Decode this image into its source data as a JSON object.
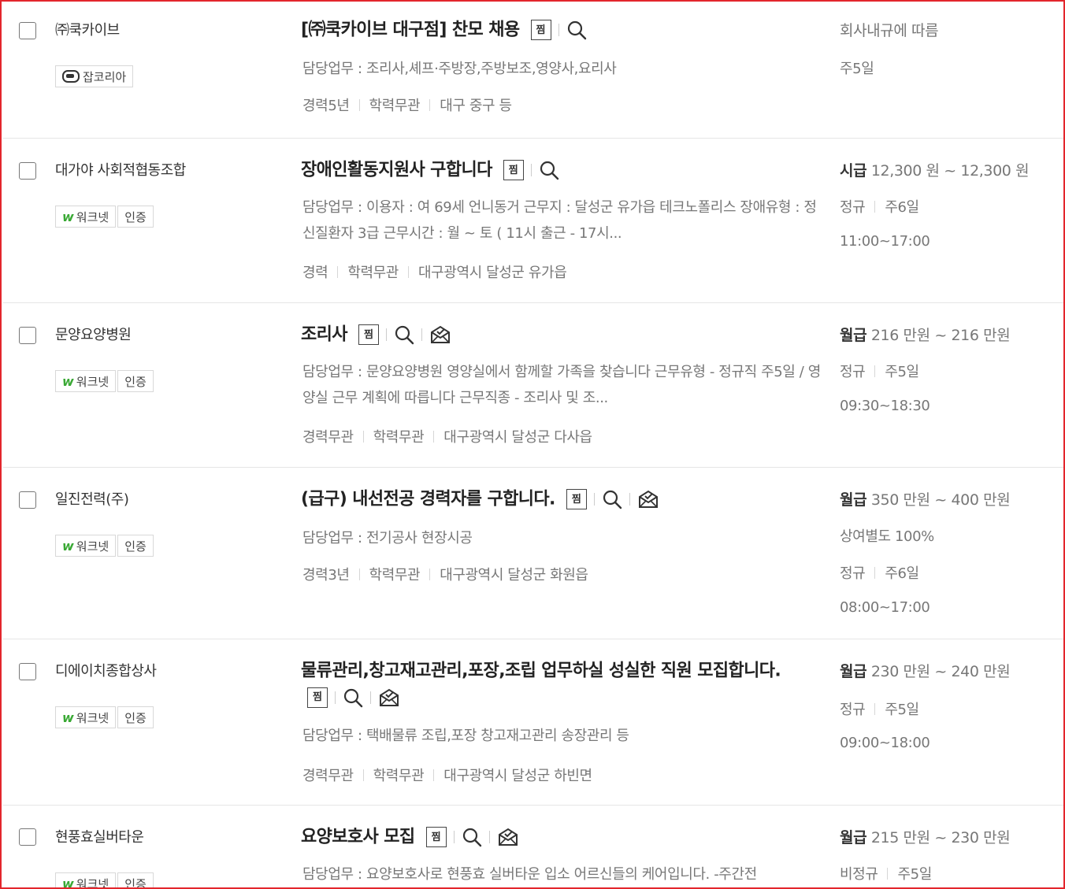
{
  "jobs": [
    {
      "company": "㈜쿡카이브",
      "badges": [
        "잡코리아"
      ],
      "badge_logo": "jobkorea",
      "title": "[㈜쿡카이브 대구점] 찬모 채용",
      "jjim_label": "찜",
      "duty": "담당업무 : 조리사,셰프·주방장,주방보조,영양사,요리사",
      "meta": [
        "경력5년",
        "학력무관",
        "대구 중구 등"
      ],
      "pay_label": "",
      "pay_value": "회사내규에 따름",
      "extra": [
        "주5일"
      ],
      "has_mail": false
    },
    {
      "company": "대가야 사회적협동조합",
      "badges": [
        "워크넷",
        "인증"
      ],
      "badge_logo": "worknet",
      "title": "장애인활동지원사 구합니다",
      "jjim_label": "찜",
      "duty": "담당업무 : 이용자 : 여 69세 언니동거 근무지 : 달성군 유가읍 테크노폴리스 장애유형 : 정신질환자 3급 근무시간 : 월 ~ 토 ( 11시 출근 - 17시...",
      "meta": [
        "경력",
        "학력무관",
        "대구광역시 달성군 유가읍"
      ],
      "pay_label": "시급",
      "pay_value": "12,300 원 ~ 12,300 원",
      "extra": [
        "정규|주6일",
        "11:00~17:00"
      ],
      "has_mail": false
    },
    {
      "company": "문양요양병원",
      "badges": [
        "워크넷",
        "인증"
      ],
      "badge_logo": "worknet",
      "title": "조리사",
      "jjim_label": "찜",
      "duty": "담당업무 : 문양요양병원 영양실에서 함께할 가족을 찾습니다 근무유형 - 정규직 주5일 / 영양실 근무 계획에 따릅니다 근무직종 - 조리사 및 조...",
      "meta": [
        "경력무관",
        "학력무관",
        "대구광역시 달성군 다사읍"
      ],
      "pay_label": "월급",
      "pay_value": "216 만원 ~ 216 만원",
      "extra": [
        "정규|주5일",
        "09:30~18:30"
      ],
      "has_mail": true
    },
    {
      "company": "일진전력(주)",
      "badges": [
        "워크넷",
        "인증"
      ],
      "badge_logo": "worknet",
      "title": "(급구) 내선전공 경력자를 구합니다.",
      "jjim_label": "찜",
      "duty": "담당업무 : 전기공사 현장시공",
      "meta": [
        "경력3년",
        "학력무관",
        "대구광역시 달성군 화원읍"
      ],
      "pay_label": "월급",
      "pay_value": "350 만원 ~ 400 만원",
      "extra": [
        "상여별도 100%",
        "정규|주6일",
        "08:00~17:00"
      ],
      "has_mail": true
    },
    {
      "company": "디에이치종합상사",
      "badges": [
        "워크넷",
        "인증"
      ],
      "badge_logo": "worknet",
      "title": "물류관리,창고재고관리,포장,조립 업무하실 성실한 직원 모집합니다.",
      "jjim_label": "찜",
      "duty": "담당업무 : 택배물류 조립,포장 창고재고관리 송장관리 등",
      "meta": [
        "경력무관",
        "학력무관",
        "대구광역시 달성군 하빈면"
      ],
      "pay_label": "월급",
      "pay_value": "230 만원 ~ 240 만원",
      "extra": [
        "정규|주5일",
        "09:00~18:00"
      ],
      "has_mail": true
    },
    {
      "company": "현풍효실버타운",
      "badges": [
        "워크넷",
        "인증"
      ],
      "badge_logo": "worknet",
      "title": "요양보호사 모집",
      "jjim_label": "찜",
      "duty": "담당업무 : 요양보호사로 현풍효 실버타운 입소 어르신들의 케어입니다. -주간전",
      "meta": [],
      "pay_label": "월급",
      "pay_value": "215 만원 ~ 230 만원",
      "extra": [
        "비정규|주5일"
      ],
      "has_mail": true
    }
  ]
}
